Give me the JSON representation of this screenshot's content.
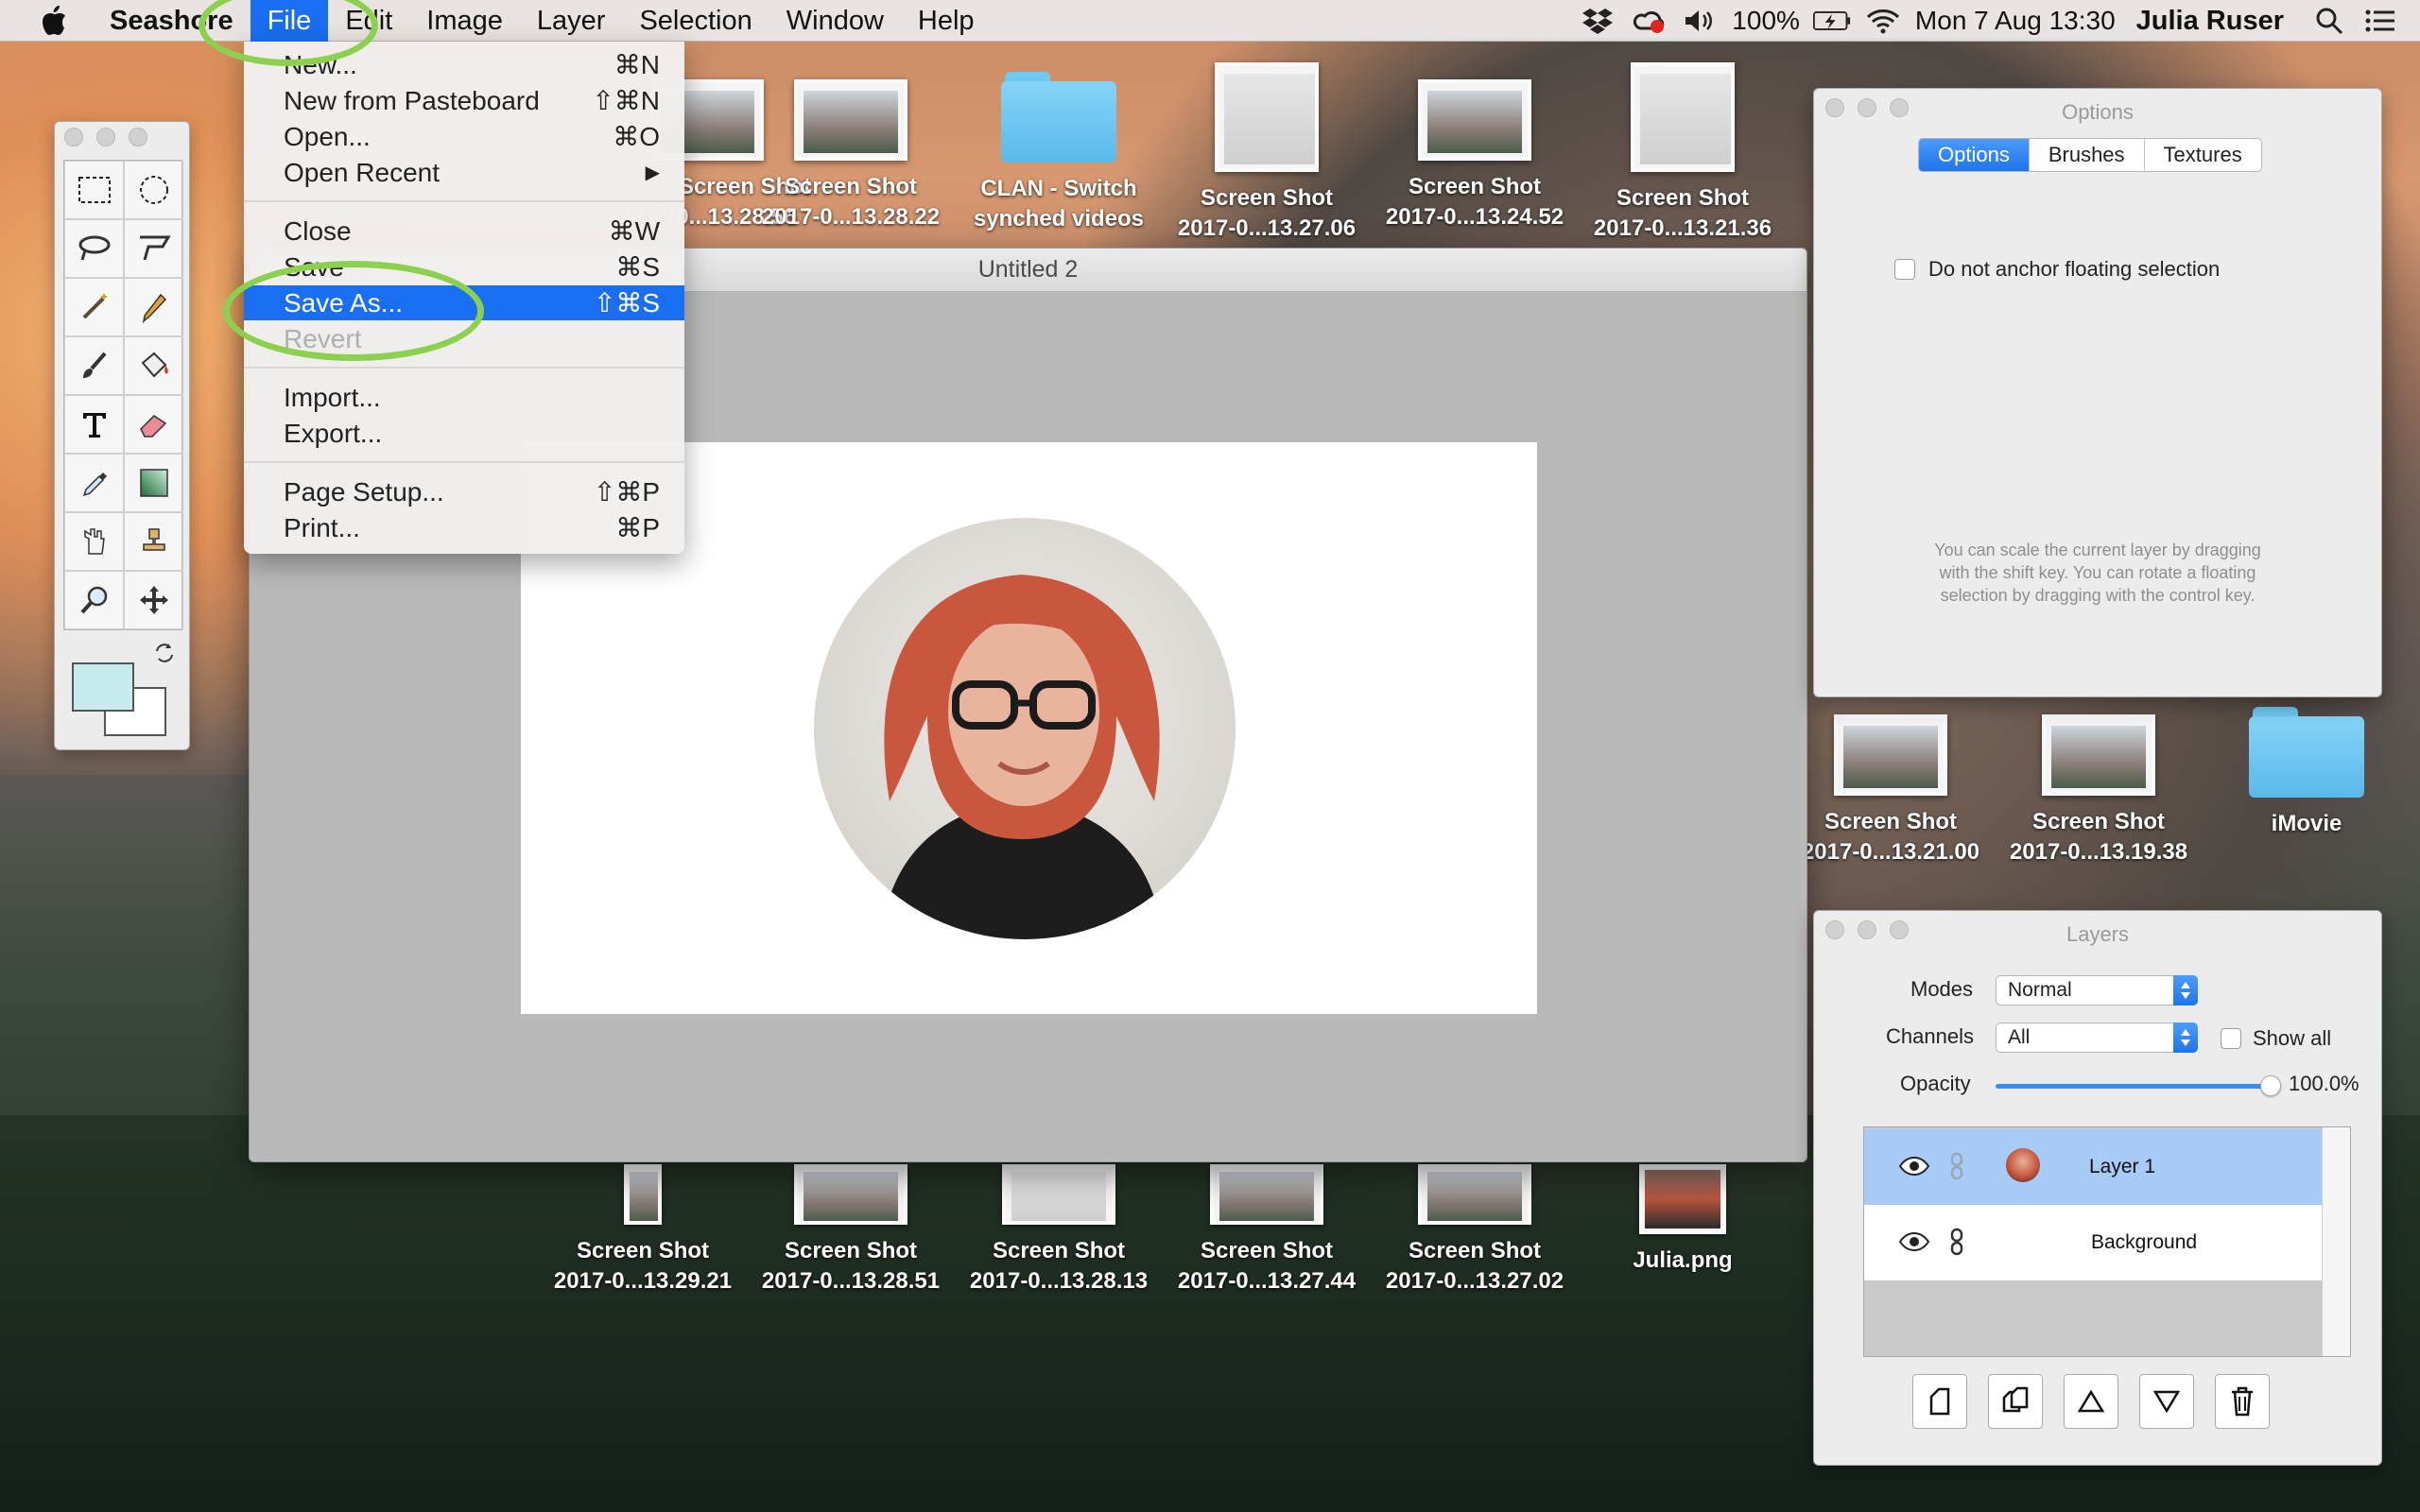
{
  "menubar": {
    "app_name": "Seashore",
    "menus": [
      "File",
      "Edit",
      "Image",
      "Layer",
      "Selection",
      "Window",
      "Help"
    ],
    "active_menu": "File",
    "battery": "100%",
    "datetime": "Mon 7 Aug  13:30",
    "user": "Julia Ruser"
  },
  "file_menu": {
    "items": [
      {
        "label": "New...",
        "shortcut": "⌘N"
      },
      {
        "label": "New from Pasteboard",
        "shortcut": "⇧⌘N"
      },
      {
        "label": "Open...",
        "shortcut": "⌘O"
      },
      {
        "label": "Open Recent",
        "shortcut": "▶"
      },
      {
        "label": "Close",
        "shortcut": "⌘W"
      },
      {
        "label": "Save",
        "shortcut": "⌘S"
      },
      {
        "label": "Save As...",
        "shortcut": "⇧⌘S"
      },
      {
        "label": "Revert",
        "shortcut": ""
      },
      {
        "label": "Import...",
        "shortcut": ""
      },
      {
        "label": "Export...",
        "shortcut": ""
      },
      {
        "label": "Page Setup...",
        "shortcut": "⇧⌘P"
      },
      {
        "label": "Print...",
        "shortcut": "⌘P"
      }
    ],
    "selected_item": "Save As...",
    "disabled_item": "Revert"
  },
  "document": {
    "title": "Untitled 2"
  },
  "desktop_icons": [
    {
      "line1": "Screen Shot",
      "line2": "2017-0...13.28.56"
    },
    {
      "line1": "Screen Shot",
      "line2": "2017-0...13.28.22"
    },
    {
      "line1": "CLAN - Switch",
      "line2": "synched videos"
    },
    {
      "line1": "Screen Shot",
      "line2": "2017-0...13.27.06"
    },
    {
      "line1": "Screen Shot",
      "line2": "2017-0...13.24.52"
    },
    {
      "line1": "Screen Shot",
      "line2": "2017-0...13.21.36"
    },
    {
      "line1": "Screen Shot",
      "line2": "2017-0...13.21.00"
    },
    {
      "line1": "Screen Shot",
      "line2": "2017-0...13.19.38"
    },
    {
      "line1": "iMovie",
      "line2": ""
    },
    {
      "line1": "Screen Shot",
      "line2": "2017-0...13.29.21"
    },
    {
      "line1": "Screen Shot",
      "line2": "2017-0...13.28.51"
    },
    {
      "line1": "Screen Shot",
      "line2": "2017-0...13.28.13"
    },
    {
      "line1": "Screen Shot",
      "line2": "2017-0...13.27.44"
    },
    {
      "line1": "Screen Shot",
      "line2": "2017-0...13.27.02"
    },
    {
      "line1": "Julia.png",
      "line2": ""
    }
  ],
  "options_panel": {
    "title": "Options",
    "tabs": [
      "Options",
      "Brushes",
      "Textures"
    ],
    "active_tab": "Options",
    "checkbox_label": "Do not anchor floating selection",
    "help_line1": "You can scale the current layer by dragging",
    "help_line2": "with the shift key. You can rotate a floating",
    "help_line3": "selection by dragging with the control key."
  },
  "layers_panel": {
    "title": "Layers",
    "modes_label": "Modes",
    "modes_value": "Normal",
    "channels_label": "Channels",
    "channels_value": "All",
    "show_all_label": "Show all",
    "opacity_label": "Opacity",
    "opacity_value": "100.0%",
    "opacity_fraction": 1.0,
    "layers": [
      {
        "name": "Layer 1",
        "selected": true
      },
      {
        "name": "Background",
        "selected": false
      }
    ],
    "buttons": [
      "new-layer-icon",
      "duplicate-layer-icon",
      "raise-layer-icon",
      "lower-layer-icon",
      "trash-icon"
    ]
  },
  "colors": {
    "accent": "#1a6ef2",
    "annotation": "#8bd04e",
    "foreground_swatch": "#c8ecee",
    "background_swatch": "#ffffff"
  }
}
